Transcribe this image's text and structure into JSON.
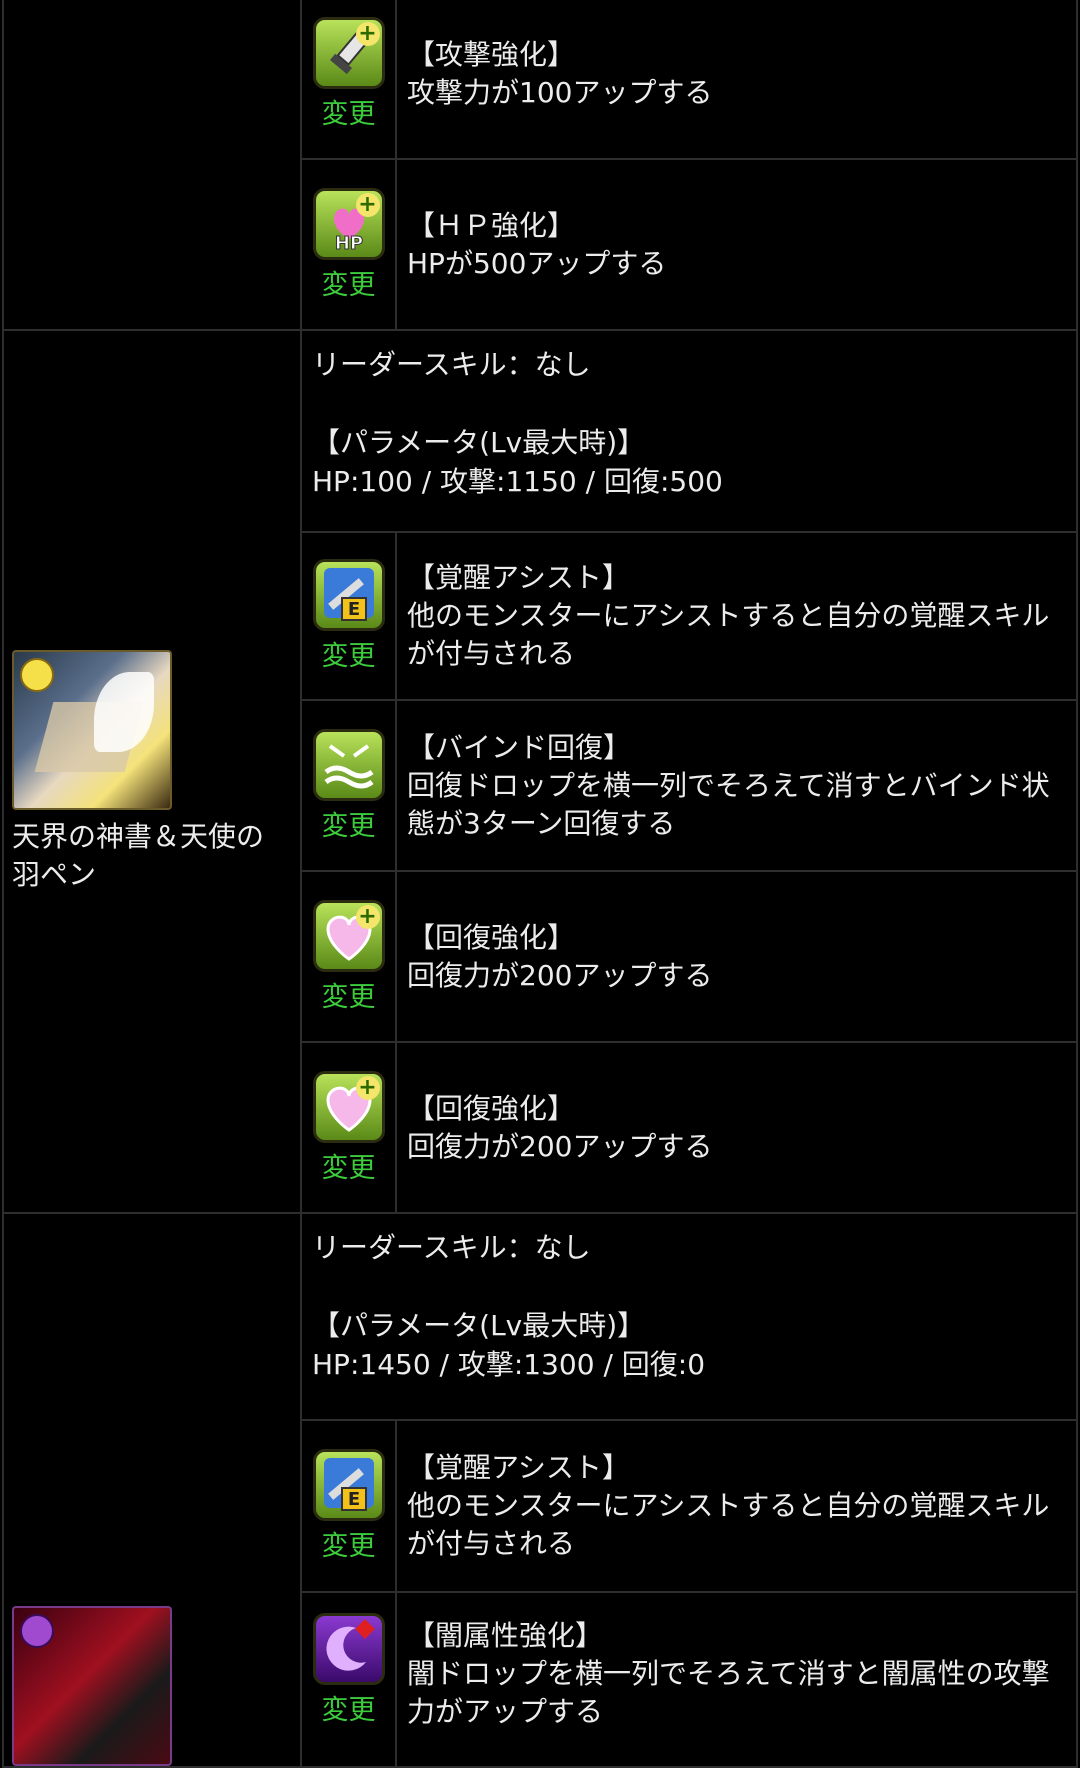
{
  "change_label": "変更",
  "rows": [
    {
      "skills": [
        {
          "title": "【攻撃強化】",
          "desc": "攻撃力が100アップする",
          "icon": "attack-up-icon"
        },
        {
          "title": "【ＨＰ強化】",
          "desc": "HPが500アップする",
          "icon": "hp-up-icon"
        }
      ]
    },
    {
      "monster_name": "天界の神書＆天使の羽ペン",
      "leader_skill": "リーダースキル：なし",
      "params_header": "【パラメータ(Lv最大時)】",
      "params": "HP:100 / 攻撃:1150 / 回復:500",
      "skills": [
        {
          "title": "【覚醒アシスト】",
          "desc": "他のモンスターにアシストすると自分の覚醒スキルが付与される",
          "icon": "awoken-assist-icon"
        },
        {
          "title": "【バインド回復】",
          "desc": "回復ドロップを横一列でそろえて消すとバインド状態が3ターン回復する",
          "icon": "bind-recovery-icon"
        },
        {
          "title": "【回復強化】",
          "desc": "回復力が200アップする",
          "icon": "recovery-up-icon"
        },
        {
          "title": "【回復強化】",
          "desc": "回復力が200アップする",
          "icon": "recovery-up-icon"
        }
      ]
    },
    {
      "leader_skill": "リーダースキル：なし",
      "params_header": "【パラメータ(Lv最大時)】",
      "params": "HP:1450 / 攻撃:1300 / 回復:0",
      "skills": [
        {
          "title": "【覚醒アシスト】",
          "desc": "他のモンスターにアシストすると自分の覚醒スキルが付与される",
          "icon": "awoken-assist-icon"
        },
        {
          "title": "【闇属性強化】",
          "desc": "闇ドロップを横一列でそろえて消すと闇属性の攻撃力がアップする",
          "icon": "dark-row-enhance-icon"
        }
      ]
    }
  ]
}
